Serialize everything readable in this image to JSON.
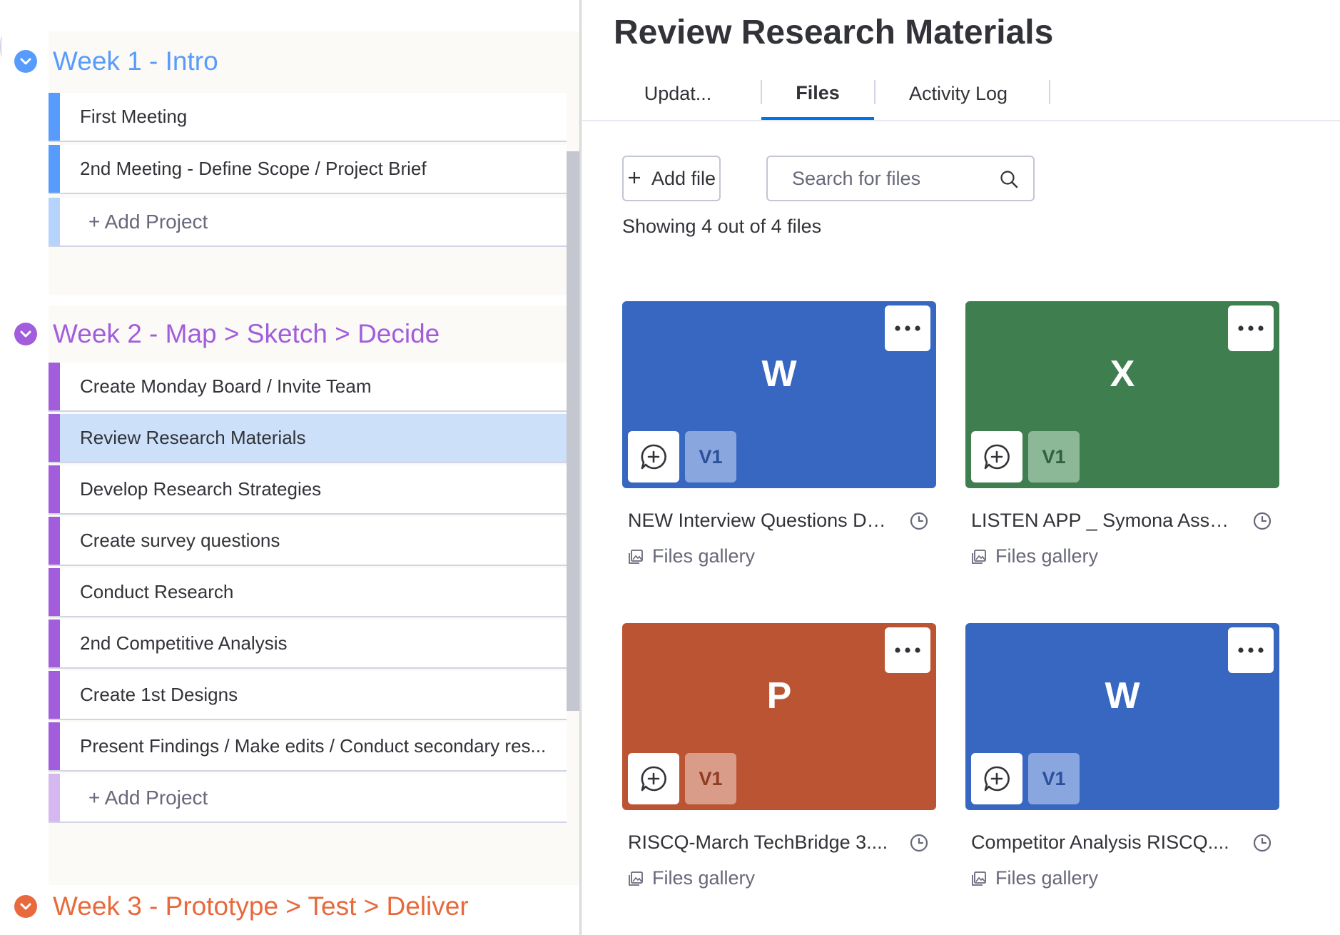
{
  "left": {
    "groups": [
      {
        "title": "Week 1 - Intro",
        "color": "#579bfc",
        "items": [
          "First Meeting",
          "2nd Meeting - Define Scope / Project Brief"
        ],
        "add_label": "+ Add Project"
      },
      {
        "title": "Week 2 - Map > Sketch > Decide",
        "color": "#a25ddc",
        "items": [
          "Create Monday Board / Invite Team",
          "Review Research Materials",
          "Develop Research Strategies",
          "Create survey questions",
          "Conduct Research",
          "2nd Competitive Analysis",
          "Create 1st Designs",
          "Present Findings / Make edits / Conduct secondary res..."
        ],
        "add_label": "+ Add Project",
        "selected_item": "Review Research Materials"
      },
      {
        "title": "Week 3 - Prototype > Test > Deliver",
        "color": "#e8693b"
      }
    ]
  },
  "right": {
    "title": "Review Research Materials",
    "tabs": [
      {
        "label": "Updat..."
      },
      {
        "label": "Files",
        "active": true
      },
      {
        "label": "Activity Log"
      }
    ],
    "add_file_label": "Add file",
    "search_placeholder": "Search for files",
    "showing_text": "Showing 4 out of 4 files",
    "files": [
      {
        "letter": "W",
        "name": "NEW Interview Questions DT...",
        "version": "V1",
        "source": "Files gallery",
        "color": "#3767c0",
        "version_bg": "#8aa6df",
        "version_color": "#2b4f9a"
      },
      {
        "letter": "X",
        "name": "LISTEN APP _ Symona Assu...",
        "version": "V1",
        "source": "Files gallery",
        "color": "#3f7e4f",
        "version_bg": "#8db898",
        "version_color": "#2f6040"
      },
      {
        "letter": "P",
        "name": "RISCQ-March TechBridge 3....",
        "version": "V1",
        "source": "Files gallery",
        "color": "#bb5433",
        "version_bg": "#d99c88",
        "version_color": "#8e3c22"
      },
      {
        "letter": "W",
        "name": "Competitor Analysis RISCQ....",
        "version": "V1",
        "source": "Files gallery",
        "color": "#3767c0",
        "version_bg": "#8aa6df",
        "version_color": "#2b4f9a"
      }
    ]
  }
}
